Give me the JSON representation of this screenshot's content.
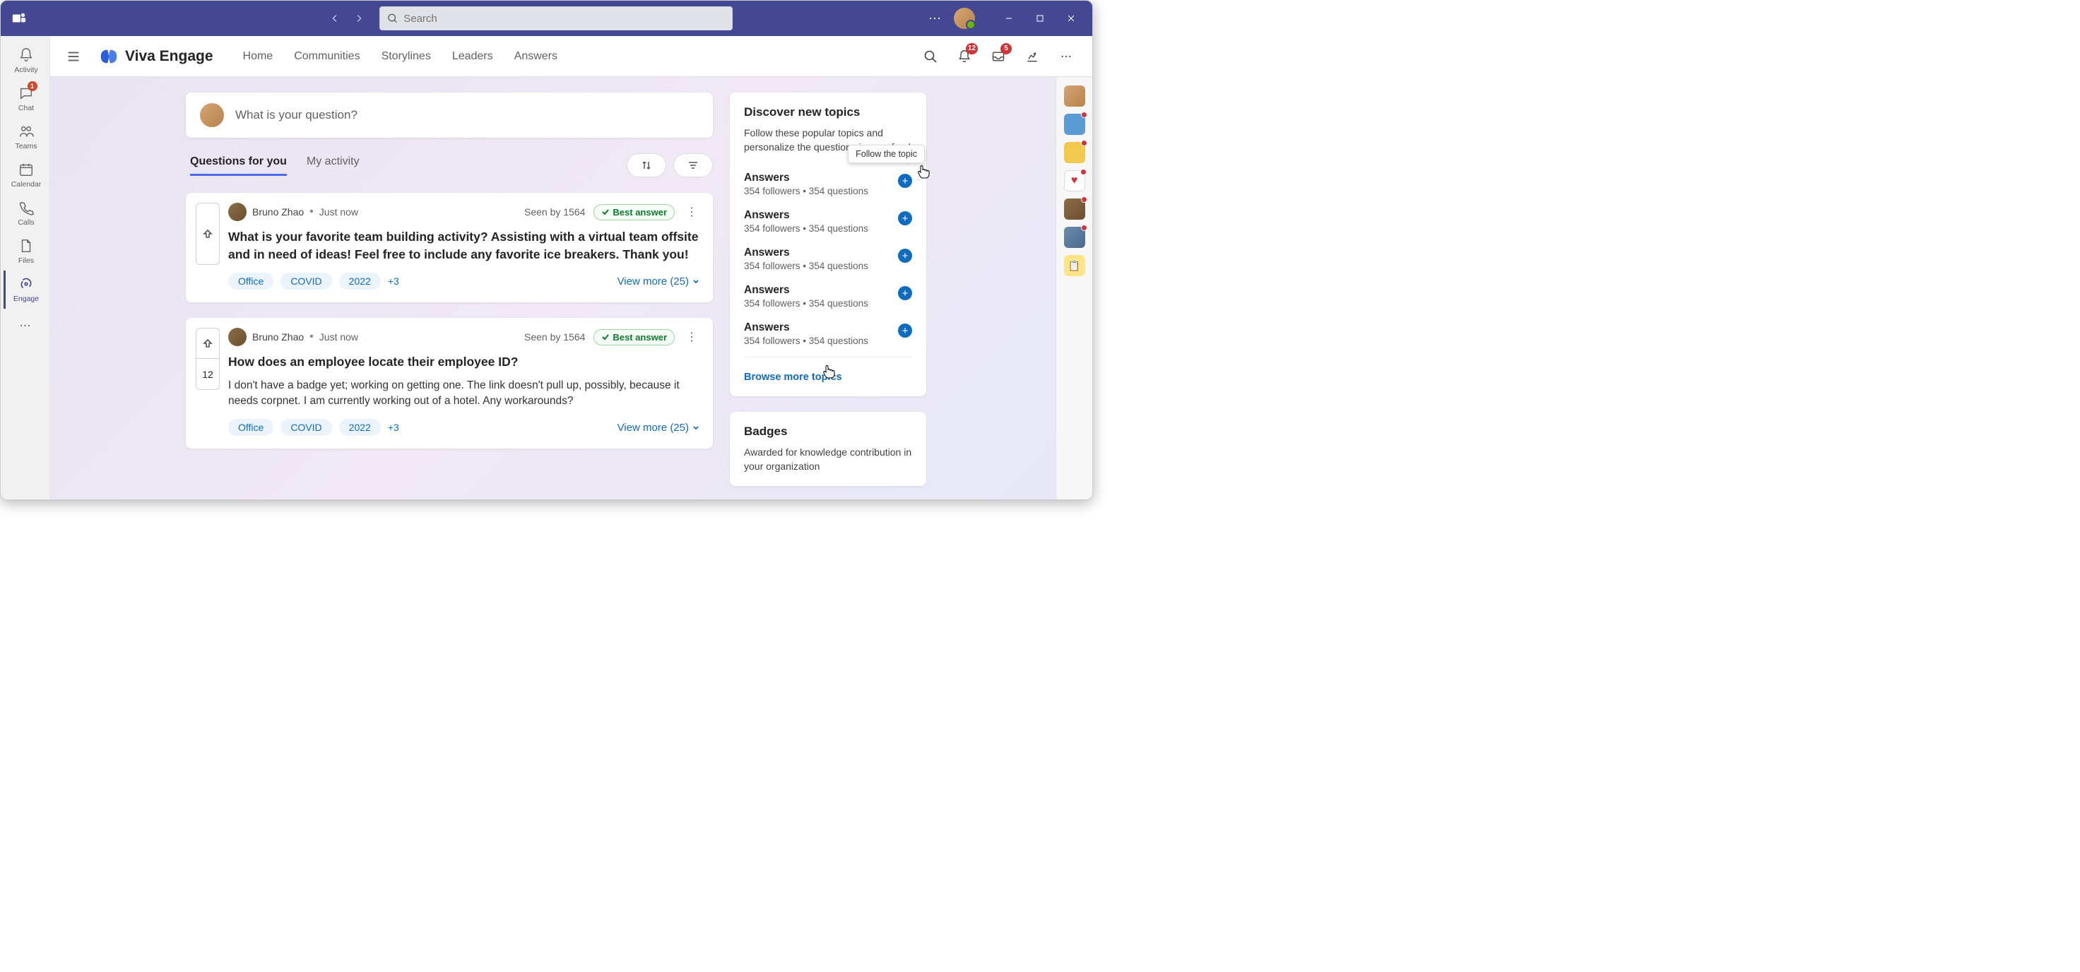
{
  "titlebar": {
    "search_placeholder": "Search"
  },
  "rail": {
    "activity": "Activity",
    "chat": "Chat",
    "chat_badge": "1",
    "teams": "Teams",
    "calendar": "Calendar",
    "calls": "Calls",
    "files": "Files",
    "engage": "Engage"
  },
  "header": {
    "brand": "Viva Engage",
    "nav": {
      "home": "Home",
      "communities": "Communities",
      "storylines": "Storylines",
      "leaders": "Leaders",
      "answers": "Answers"
    },
    "notif_badge": "12",
    "inbox_badge": "5"
  },
  "composer": {
    "prompt": "What is your question?"
  },
  "tabs": {
    "for_you": "Questions for you",
    "my_activity": "My activity"
  },
  "questions": [
    {
      "author": "Bruno Zhao",
      "time": "Just now",
      "seen": "Seen by 1564",
      "best": "Best answer",
      "title": "What is your favorite team building activity? Assisting with a virtual team offsite and in need of ideas! Feel free to include any favorite ice breakers. Thank you!",
      "tags": [
        "Office",
        "COVID",
        "2022"
      ],
      "tag_more": "+3",
      "view_more": "View more (25)",
      "votes": null
    },
    {
      "author": "Bruno Zhao",
      "time": "Just now",
      "seen": "Seen by 1564",
      "best": "Best answer",
      "title": "How does an employee locate their employee ID?",
      "desc": "I don't have a badge yet; working on getting one. The link doesn't pull up, possibly, because it needs corpnet. I am currently working out of a hotel. Any workarounds?",
      "tags": [
        "Office",
        "COVID",
        "2022"
      ],
      "tag_more": "+3",
      "view_more": "View more (25)",
      "votes": "12"
    }
  ],
  "discover": {
    "title": "Discover new topics",
    "subtitle": "Follow these popular topics and personalize the questions in your feed",
    "tooltip": "Follow the topic",
    "topics": [
      {
        "name": "Answers",
        "meta": "354 followers • 354 questions"
      },
      {
        "name": "Answers",
        "meta": "354 followers • 354 questions"
      },
      {
        "name": "Answers",
        "meta": "354 followers • 354 questions"
      },
      {
        "name": "Answers",
        "meta": "354 followers • 354 questions"
      },
      {
        "name": "Answers",
        "meta": "354 followers • 354 questions"
      }
    ],
    "browse": "Browse more topics"
  },
  "badges": {
    "title": "Badges",
    "subtitle": "Awarded for knowledge contribution in your organization"
  }
}
